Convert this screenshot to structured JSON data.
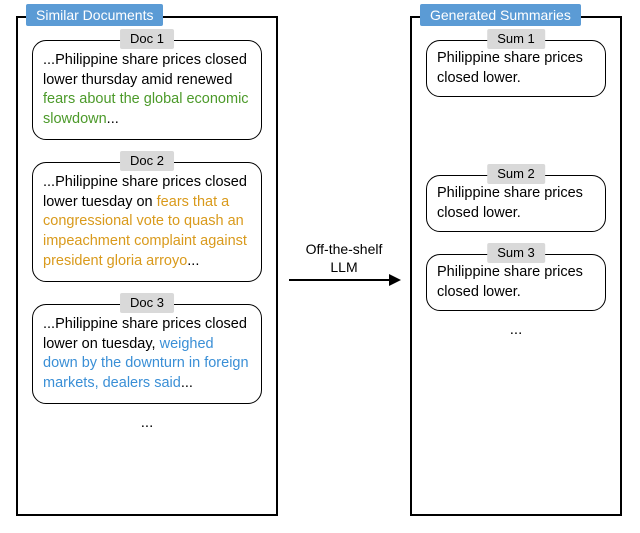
{
  "left_panel": {
    "title": "Similar Documents",
    "ellipsis": "...",
    "docs": [
      {
        "tag": "Doc 1",
        "pre": "...Philippine share prices closed lower thursday amid renewed ",
        "hl": "fears about the global economic slowdown",
        "post": "...",
        "hl_class": "hl-green"
      },
      {
        "tag": "Doc 2",
        "pre": "...Philippine share prices closed lower tuesday on ",
        "hl": "fears that a congressional vote to quash an impeachment complaint against president gloria arroyo",
        "post": "...",
        "hl_class": "hl-orange"
      },
      {
        "tag": "Doc 3",
        "pre": "...Philippine share prices closed lower on tuesday, ",
        "hl": "weighed down by the downturn in foreign markets, dealers said",
        "post": "...",
        "hl_class": "hl-blue"
      }
    ]
  },
  "right_panel": {
    "title": "Generated Summaries",
    "ellipsis": "...",
    "sums": [
      {
        "tag": "Sum 1",
        "text": "Philippine share prices closed lower."
      },
      {
        "tag": "Sum 2",
        "text": "Philippine share prices closed lower."
      },
      {
        "tag": "Sum 3",
        "text": "Philippine share prices closed lower."
      }
    ]
  },
  "arrow": {
    "label_line1": "Off-the-shelf",
    "label_line2": "LLM"
  }
}
